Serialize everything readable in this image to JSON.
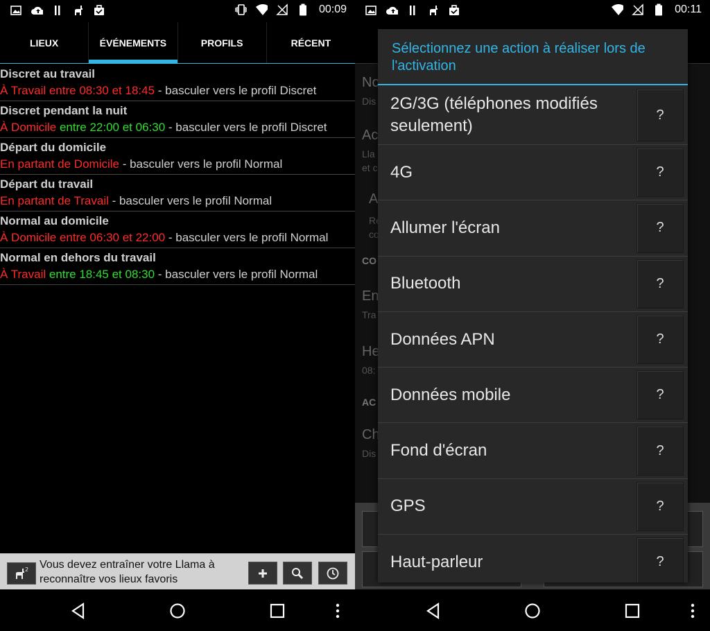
{
  "left": {
    "status": {
      "time": "00:09"
    },
    "tabs": [
      {
        "label": "LIEUX"
      },
      {
        "label": "ÉVÉNEMENTS"
      },
      {
        "label": "PROFILS"
      },
      {
        "label": "RÉCENT"
      }
    ],
    "events": [
      {
        "title": "Discret au travail",
        "parts": [
          "À Travail entre 08:30 et 18:45",
          " - basculer vers le profil Discret"
        ]
      },
      {
        "title": "Discret pendant la nuit",
        "parts": [
          "À Domicile",
          " entre 22:00 et 06:30",
          " - basculer vers le profil Discret"
        ]
      },
      {
        "title": "Départ du domicile",
        "parts": [
          "En partant de Domicile",
          " - basculer vers le profil Normal"
        ]
      },
      {
        "title": "Départ du travail",
        "parts": [
          "En partant de Travail",
          " - basculer vers le profil Normal"
        ]
      },
      {
        "title": "Normal au domicile",
        "parts": [
          "À Domicile entre 06:30 et 22:00",
          " - basculer vers le profil Normal"
        ]
      },
      {
        "title": "Normal en dehors du travail",
        "parts": [
          "À Travail",
          " entre 18:45 et 08:30",
          " - basculer vers le profil Normal"
        ]
      }
    ],
    "info_bar": {
      "text": "Vous devez entraîner votre Llama à reconnaître vos lieux favoris"
    }
  },
  "right": {
    "status": {
      "time": "00:11"
    },
    "background_rows": [
      "No",
      "Dis",
      "Ac",
      "Lla",
      "et c",
      "A",
      "Re",
      "co",
      "CO",
      "En",
      "Tra",
      "He",
      "08:",
      "AC",
      "Ch",
      "Dis"
    ],
    "dialog": {
      "title": "Sélectionnez une action à réaliser lors de l'activation",
      "help_label": "?",
      "items": [
        "2G/3G (téléphones modifiés seulement)",
        "4G",
        "Allumer l'écran",
        "Bluetooth",
        "Données APN",
        "Données mobile",
        "Fond d'écran",
        "GPS",
        "Haut-parleur"
      ]
    }
  },
  "colors": {
    "accent": "#33b5e5",
    "red": "#ff2a2a",
    "green": "#33dd33"
  }
}
